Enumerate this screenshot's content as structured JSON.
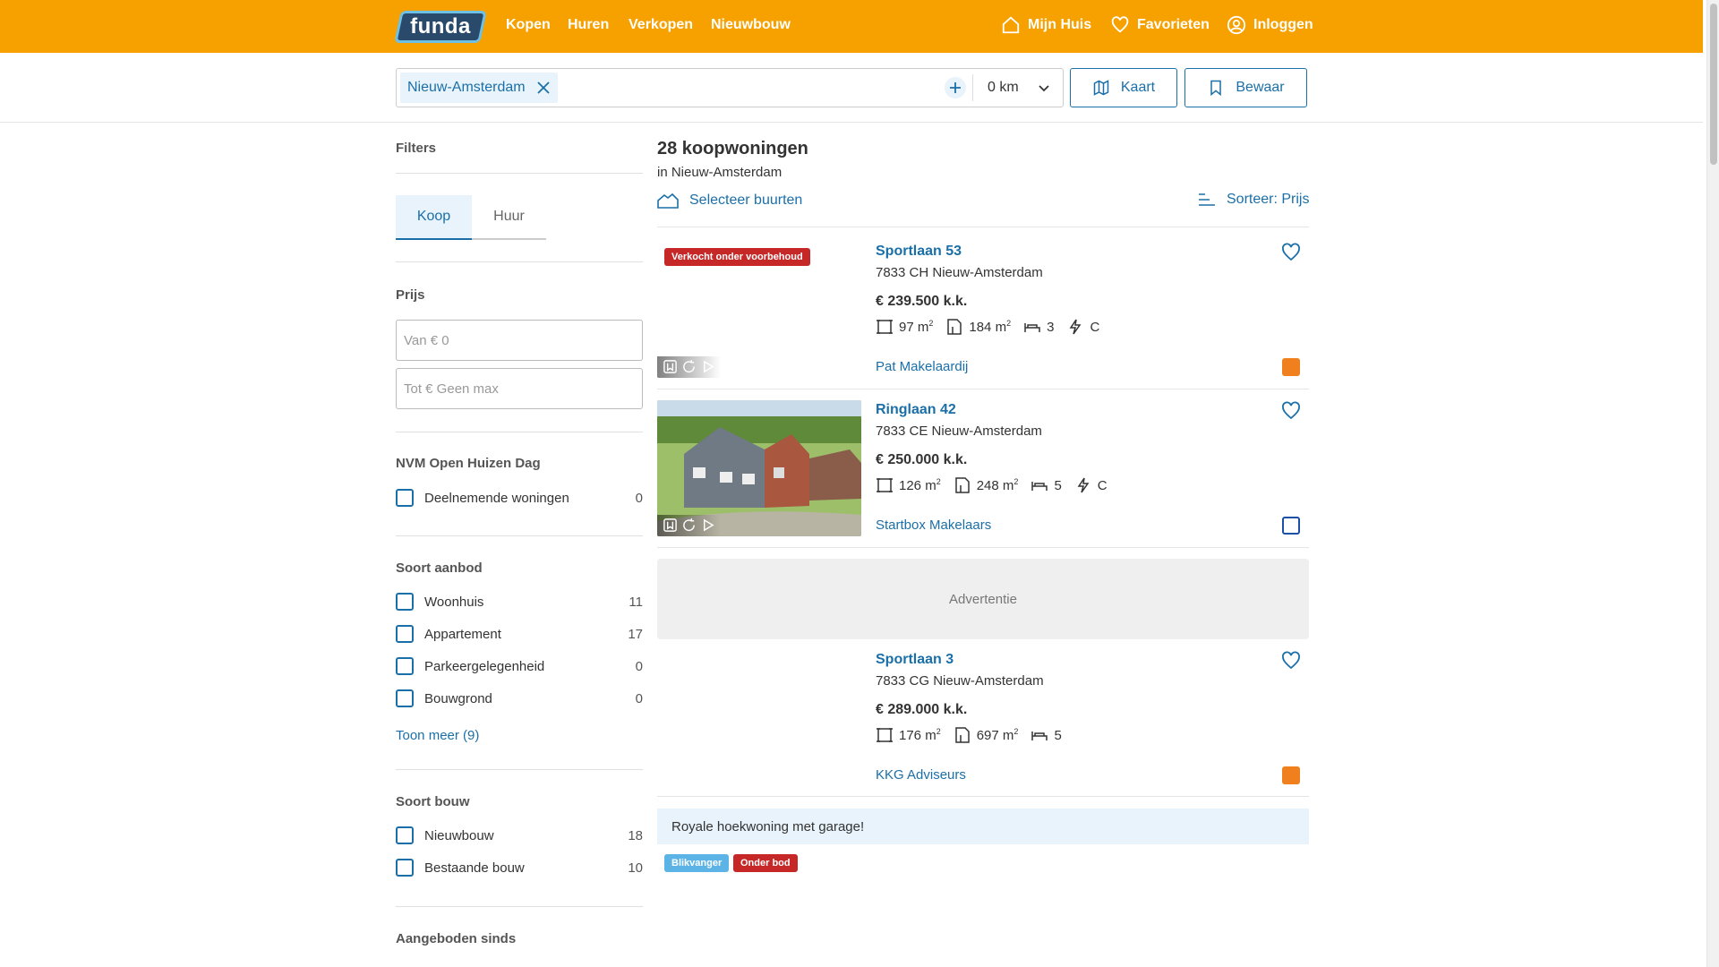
{
  "header": {
    "logo_text": "funda",
    "nav": [
      "Kopen",
      "Huren",
      "Verkopen",
      "Nieuwbouw"
    ],
    "mijn_huis": "Mijn Huis",
    "favorieten": "Favorieten",
    "inloggen": "Inloggen",
    "brand_color": "#f7a100"
  },
  "search": {
    "location_chip": "Nieuw-Amsterdam",
    "radius": "0 km",
    "kaart_label": "Kaart",
    "bewaar_label": "Bewaar"
  },
  "filters": {
    "title": "Filters",
    "tab_koop": "Koop",
    "tab_huur": "Huur",
    "prijs_title": "Prijs",
    "van_placeholder": "Van € 0",
    "tot_placeholder": "Tot € Geen max",
    "open_huis_title": "NVM Open Huizen Dag",
    "open_huis_items": [
      {
        "label": "Deelnemende woningen",
        "count": "0"
      }
    ],
    "soort_aanbod_title": "Soort aanbod",
    "soort_aanbod_items": [
      {
        "label": "Woonhuis",
        "count": "11"
      },
      {
        "label": "Appartement",
        "count": "17"
      },
      {
        "label": "Parkeergelegenheid",
        "count": "0"
      },
      {
        "label": "Bouwgrond",
        "count": "0"
      }
    ],
    "toon_meer": "Toon meer (9)",
    "soort_bouw_title": "Soort bouw",
    "soort_bouw_items": [
      {
        "label": "Nieuwbouw",
        "count": "18"
      },
      {
        "label": "Bestaande bouw",
        "count": "10"
      }
    ],
    "aangeboden_title": "Aangeboden sinds"
  },
  "results": {
    "count_title": "28 koopwoningen",
    "subtitle": "in Nieuw-Amsterdam",
    "buurten_label": "Selecteer buurten",
    "sort_label": "Sorteer: Prijs",
    "listings": [
      {
        "badge": "Verkocht onder voorbehoud",
        "address": "Sportlaan 53",
        "postal": "7833 CH Nieuw-Amsterdam",
        "price": "€ 239.500 k.k.",
        "living": "97 m",
        "plot": "184 m",
        "rooms": "3",
        "energy": "C",
        "agent": "Pat Makelaardij"
      },
      {
        "address": "Ringlaan 42",
        "postal": "7833 CE Nieuw-Amsterdam",
        "price": "€ 250.000 k.k.",
        "living": "126 m",
        "plot": "248 m",
        "rooms": "5",
        "energy": "C",
        "agent": "Startbox Makelaars"
      },
      {
        "address": "Sportlaan 3",
        "postal": "7833 CG Nieuw-Amsterdam",
        "price": "€ 289.000 k.k.",
        "living": "176 m",
        "plot": "697 m",
        "rooms": "5",
        "agent": "KKG Adviseurs"
      }
    ],
    "ad_label": "Advertentie",
    "promo_text": "Royale hoekwoning met garage!",
    "promo_badges": [
      "Blikvanger",
      "Onder bod"
    ],
    "m2_superscript": "2"
  }
}
